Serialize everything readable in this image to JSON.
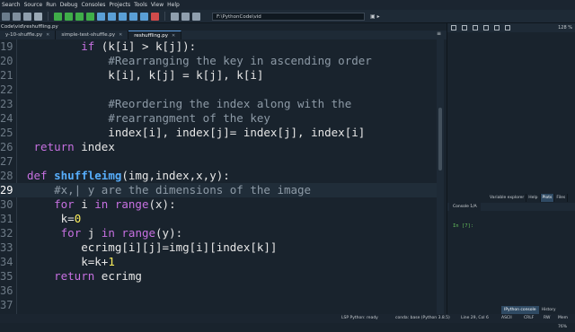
{
  "menu": [
    "Search",
    "Source",
    "Run",
    "Debug",
    "Consoles",
    "Projects",
    "Tools",
    "View",
    "Help"
  ],
  "toolbar": {
    "path": "F:\\PythonCode\\vid"
  },
  "editor": {
    "filepath": "Code\\vid\\reshuffling.py",
    "tabs": [
      {
        "label": "y-10-shuffle.py",
        "active": false
      },
      {
        "label": "simple-test-shuffle.py",
        "active": false
      },
      {
        "label": "reshuffling.py",
        "active": true
      }
    ]
  },
  "code_lines": [
    {
      "num": "19",
      "html": "        <span class='kw'>if</span> (k[i] &gt; k[j]):"
    },
    {
      "num": "20",
      "html": "            <span class='cm'>#Rearranging the key in ascending order</span>"
    },
    {
      "num": "21",
      "html": "            k[i], k[j] = k[j], k[i]"
    },
    {
      "num": "22",
      "html": ""
    },
    {
      "num": "23",
      "html": "            <span class='cm'>#Reordering the index along with the</span>"
    },
    {
      "num": "24",
      "html": "            <span class='cm'>#rearrangment of the key</span>"
    },
    {
      "num": "25",
      "html": "            index[i], index[j]= index[j], index[i]"
    },
    {
      "num": "26",
      "html": " <span class='kw'>return</span> index"
    },
    {
      "num": "27",
      "html": ""
    },
    {
      "num": "28",
      "html": "<span class='kw'>def</span> <span class='fn'>shuffleimg</span>(img,index,x,y):"
    },
    {
      "num": "29",
      "html": "    <span class='cm'>#x,| y are the dimensions of the image</span>",
      "current": true
    },
    {
      "num": "30",
      "html": "    <span class='kw'>for</span> i <span class='kw'>in</span> <span class='bi'>range</span>(x):"
    },
    {
      "num": "31",
      "html": "     k=<span class='num'>0</span>"
    },
    {
      "num": "32",
      "html": "     <span class='kw'>for</span> j <span class='kw'>in</span> <span class='bi'>range</span>(y):"
    },
    {
      "num": "33",
      "html": "        ecrimg[i][j]=img[i][index[k]]"
    },
    {
      "num": "34",
      "html": "        k=k+<span class='num'>1</span>"
    },
    {
      "num": "35",
      "html": "    <span class='kw'>return</span> ecrimg"
    },
    {
      "num": "36",
      "html": ""
    },
    {
      "num": "37",
      "html": ""
    }
  ],
  "right_panel": {
    "zoom": "128 %",
    "pane_tabs": [
      {
        "label": "Variable explorer",
        "active": false
      },
      {
        "label": "Help",
        "active": false
      },
      {
        "label": "Plots",
        "active": true
      },
      {
        "label": "Files",
        "active": false
      }
    ],
    "console_tab": "Console 1/A",
    "prompt": "In [7]:",
    "bottom_tabs": [
      {
        "label": "IPython console",
        "active": true
      },
      {
        "label": "History",
        "active": false
      }
    ]
  },
  "statusbar": {
    "lsp": "LSP Python: ready",
    "conda": "conda: base (Python 3.8.5)",
    "position": "Line 29, Col 6",
    "encoding": "ASCII",
    "eol": "CRLF",
    "mode": "RW",
    "memory": "Mem 76%"
  },
  "colors": {
    "background": "#19232d",
    "keyword": "#c670e0",
    "comment": "#8d9aa6",
    "function": "#57aefc",
    "number": "#faed5c"
  }
}
